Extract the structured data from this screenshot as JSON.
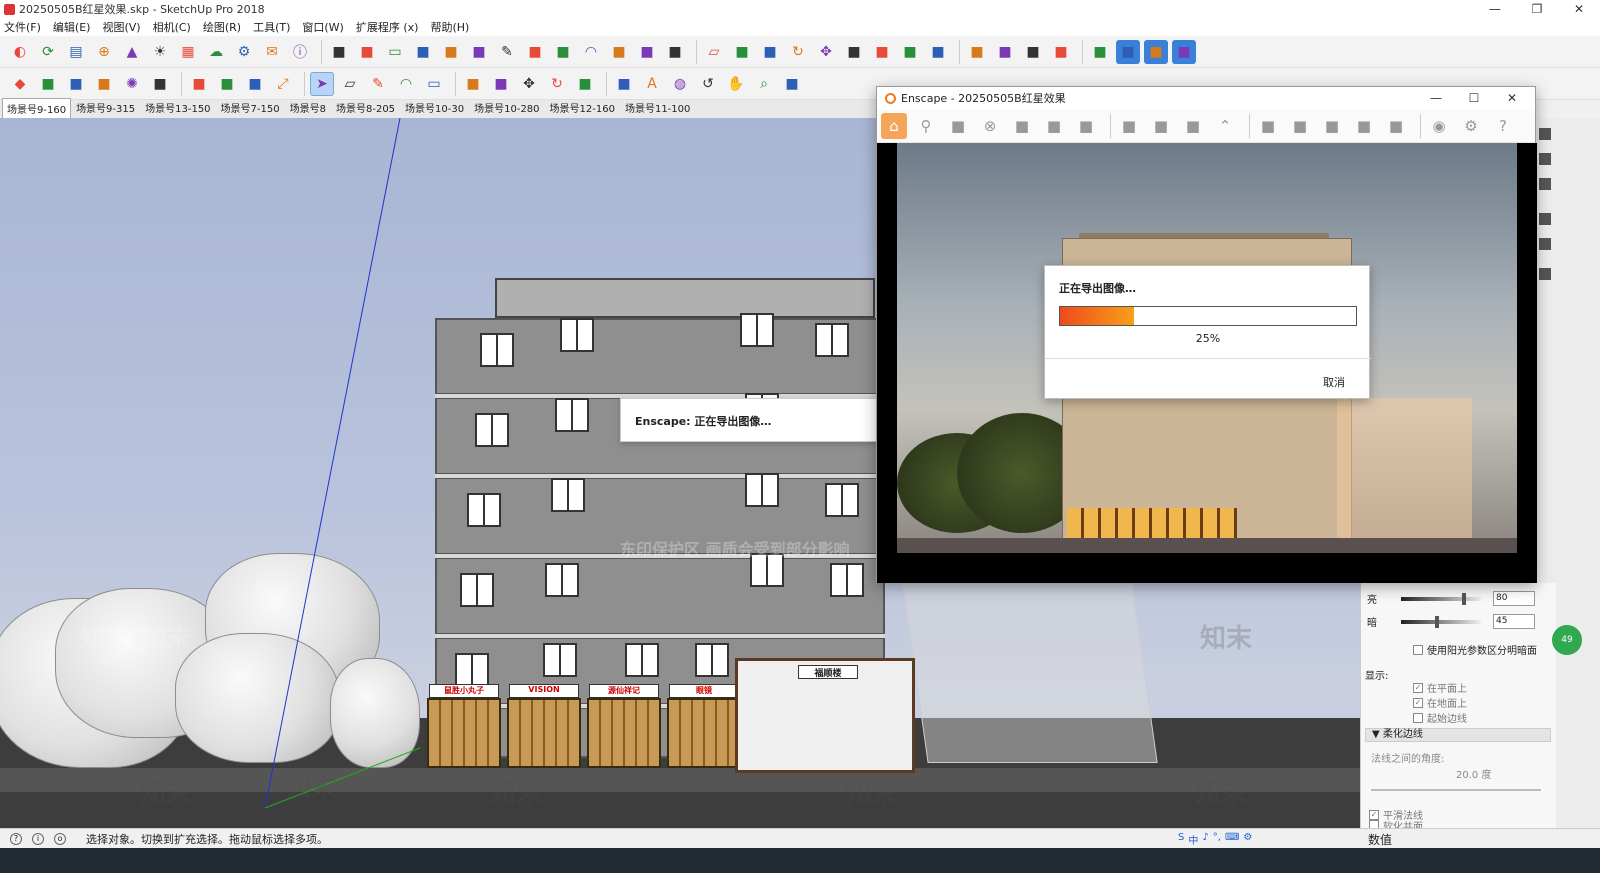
{
  "window": {
    "title": "20250505B红星效果.skp - SketchUp Pro 2018",
    "minimize": "—",
    "maximize": "❐",
    "close": "✕"
  },
  "menu": [
    "文件(F)",
    "编辑(E)",
    "视图(V)",
    "相机(C)",
    "绘图(R)",
    "工具(T)",
    "窗口(W)",
    "扩展程序 (x)",
    "帮助(H)"
  ],
  "toolbar1_icons": [
    "enscape-logo-icon",
    "refresh-sync-icon",
    "capture-icon",
    "plus-circle-icon",
    "tree-icon",
    "sun-icon",
    "checker-icon",
    "cloud-upload-icon",
    "gear-icon",
    "mail-icon",
    "info-icon",
    "cube-icon",
    "box-icon",
    "rect-icon",
    "fence-icon",
    "stairs-icon",
    "ruler-icon",
    "pencil-icon",
    "knife-icon",
    "curve-icon",
    "arc-icon",
    "path-icon",
    "node-icon",
    "line-icon",
    "eraser-icon",
    "extrude-icon",
    "box3d-icon",
    "rotate-icon",
    "move-icon",
    "offset-icon",
    "section-icon",
    "layer-icon",
    "plugin-icon",
    "pin-icon",
    "sword-icon",
    "b-icon",
    "su-app-icon",
    "axis-icon",
    "view-icon",
    "view-iso-icon",
    "view-top-icon"
  ],
  "toolbar2_icons": [
    "gem-icon",
    "ruby-icon",
    "tag-icon",
    "swirl-icon",
    "bulb-icon",
    "tape-icon",
    "ph-icon",
    "doc-icon",
    "doc2-icon",
    "resize-icon",
    "select-icon",
    "eraser-icon",
    "pencil-icon",
    "arc-icon",
    "rect-icon",
    "push-pull-icon",
    "follow-me-icon",
    "move-icon",
    "rotate-icon",
    "scale-icon",
    "tape-measure-icon",
    "text-icon",
    "paint-icon",
    "orbit-icon",
    "pan-icon",
    "zoom-icon",
    "zoom-extents-icon"
  ],
  "scene_tabs": [
    "场景号9-160",
    "场景号9-315",
    "场景号13-150",
    "场景号7-150",
    "场景号8",
    "场景号8-205",
    "场景号10-30",
    "场景号10-280",
    "场景号12-160",
    "场景号11-100"
  ],
  "viewport": {
    "export_toast": "Enscape: 正在导出图像…",
    "shop_signs": [
      "鼠胜小丸子",
      "VISION",
      "源仙祥记",
      "眼镜"
    ],
    "gate_sign": "福顺楼",
    "watermarks": [
      "知末",
      "知末",
      "知末",
      "知末",
      "知末",
      "知末",
      "知末",
      "知末"
    ],
    "watermark_banner": "东印保护区 画质会受到部分影响"
  },
  "enscape": {
    "title": "Enscape - 20250505B红星效果",
    "minimize": "—",
    "maximize": "☐",
    "close": "✕",
    "toolbar_icons": [
      "home-icon",
      "map-pin-icon",
      "bim-icon",
      "binoculars-icon",
      "asset-icon",
      "building-icon",
      "clapper-icon",
      "screenshot-icon",
      "batch-render-icon",
      "panorama-icon",
      "chevron-up-icon",
      "book-icon",
      "video-icon",
      "cube-icon",
      "chart-icon",
      "vr-icon",
      "eye-icon",
      "settings-icon",
      "help-icon"
    ],
    "progress": {
      "title": "正在导出图像…",
      "percent_label": "25%",
      "value": 0.25,
      "cancel": "取消"
    }
  },
  "tray": {
    "light_label": "亮",
    "light_value": "80",
    "light_level": 0.8,
    "dark_label": "暗",
    "dark_value": "45",
    "dark_level": 0.45,
    "sun_shading_label": "使用阳光参数区分明暗面",
    "display_label": "显示:",
    "on_faces": "在平面上",
    "on_ground": "在地面上",
    "from_edges": "起始边线",
    "soften_header": "柔化边线",
    "angle_label": "法线之间的角度:",
    "angle_value": "20.0 度",
    "smooth_normals": "平滑法线",
    "soften_coplanar": "软化共面"
  },
  "status": {
    "message": "选择对象。切换到扩充选择。拖动鼠标选择多项。",
    "value_label": "数值",
    "ime": [
      "S",
      "中",
      "♪",
      "°,",
      "⌨",
      "⚙"
    ],
    "badge": "49"
  },
  "colors": {
    "enscape_orange": "#f07a1c",
    "progress_start": "#f04a1c",
    "progress_end": "#f7a01a",
    "sky": "#a8b6d4"
  }
}
